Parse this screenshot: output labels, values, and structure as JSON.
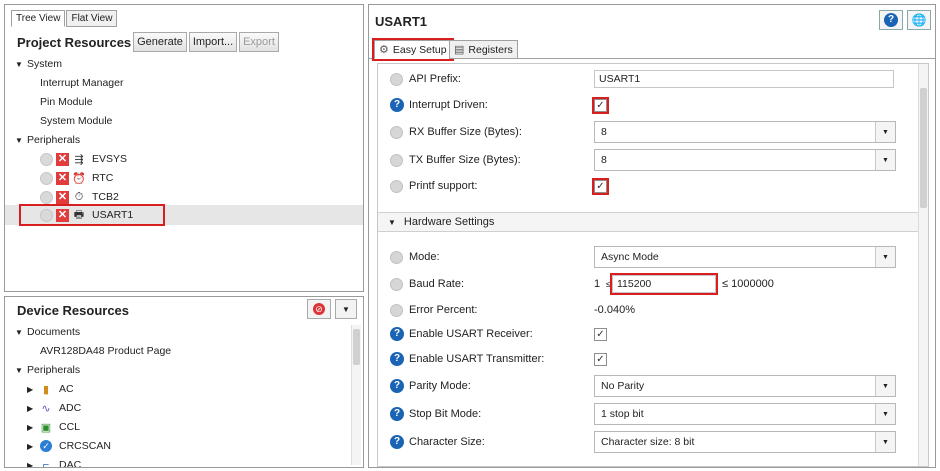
{
  "left_top": {
    "tabs": [
      "Tree View",
      "Flat View"
    ],
    "title": "Project Resources",
    "buttons": {
      "generate": "Generate",
      "import": "Import...",
      "export": "Export"
    },
    "system": {
      "label": "System",
      "items": [
        "Interrupt Manager",
        "Pin Module",
        "System Module"
      ]
    },
    "peripherals": {
      "label": "Peripherals",
      "items": [
        {
          "label": "EVSYS",
          "icon": "evsys-icon"
        },
        {
          "label": "RTC",
          "icon": "clock-icon"
        },
        {
          "label": "TCB2",
          "icon": "timer-icon"
        },
        {
          "label": "USART1",
          "icon": "printer-icon"
        }
      ]
    }
  },
  "left_bottom": {
    "title": "Device Resources",
    "documents": {
      "label": "Documents",
      "items": [
        "AVR128DA48 Product Page"
      ]
    },
    "peripherals": {
      "label": "Peripherals",
      "items": [
        "AC",
        "ADC",
        "CCL",
        "CRCSCAN",
        "DAC"
      ]
    }
  },
  "right": {
    "title": "USART1",
    "tabs": {
      "easy_setup": "Easy Setup",
      "registers": "Registers"
    },
    "api_prefix": {
      "label": "API Prefix:",
      "value": "USART1"
    },
    "interrupt_driven": {
      "label": "Interrupt Driven:",
      "checked": true
    },
    "rx_buffer": {
      "label": "RX Buffer Size (Bytes):",
      "value": "8"
    },
    "tx_buffer": {
      "label": "TX Buffer Size (Bytes):",
      "value": "8"
    },
    "printf": {
      "label": "Printf support:",
      "checked": true
    },
    "hardware_section": "Hardware Settings",
    "mode": {
      "label": "Mode:",
      "value": "Async Mode"
    },
    "baud": {
      "label": "Baud Rate:",
      "min": "1",
      "le1": "≤",
      "value": "115200",
      "max": "≤ 1000000"
    },
    "error": {
      "label": "Error Percent:",
      "value": "-0.040%"
    },
    "receiver": {
      "label": "Enable USART Receiver:",
      "checked": true
    },
    "transmitter": {
      "label": "Enable USART Transmitter:",
      "checked": true
    },
    "parity": {
      "label": "Parity Mode:",
      "value": "No Parity"
    },
    "stop_bit": {
      "label": "Stop Bit Mode:",
      "value": "1 stop bit"
    },
    "char_size": {
      "label": "Character Size:",
      "value": "Character size: 8 bit"
    }
  },
  "colors": {
    "highlight": "#d81e1e",
    "help_blue": "#1b63b5"
  }
}
